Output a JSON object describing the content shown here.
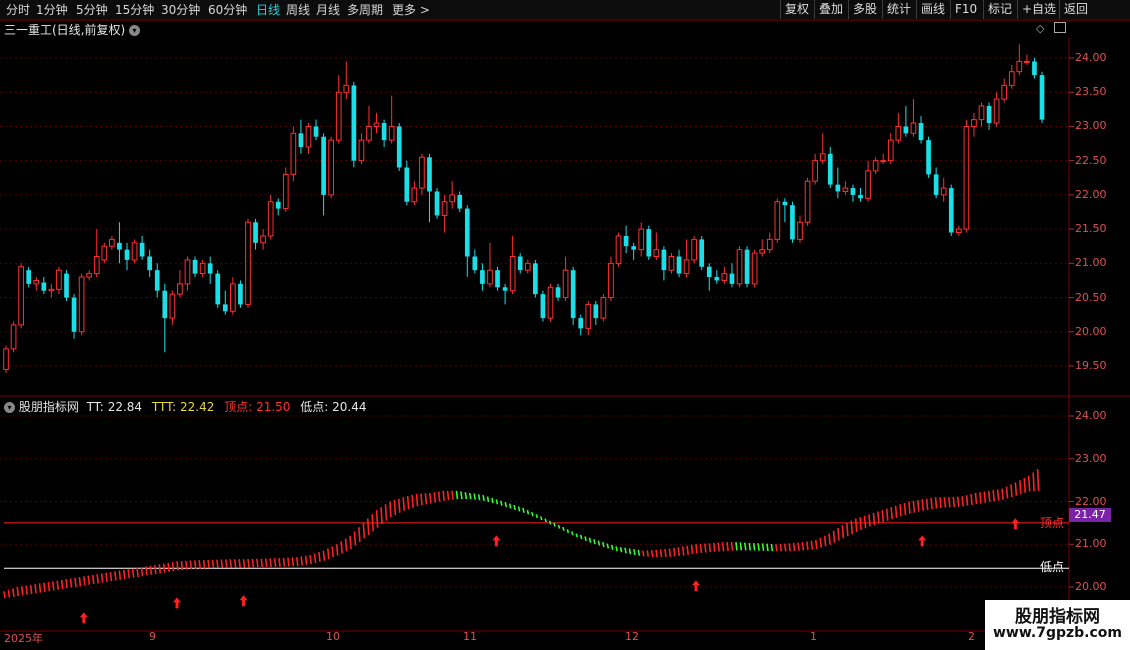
{
  "toolbar": {
    "periods": [
      "分时",
      "1分钟",
      "5分钟",
      "15分钟",
      "30分钟",
      "60分钟",
      "日线",
      "周线",
      "月线",
      "多周期",
      "更多 >"
    ],
    "active_period": "日线",
    "buttons": [
      "复权",
      "叠加",
      "多股",
      "统计",
      "画线",
      "F10",
      "标记",
      "+自选",
      "返回"
    ]
  },
  "main_chart": {
    "title": "三一重工(日线,前复权)",
    "price_labels": [
      "24.00",
      "23.50",
      "23.00",
      "22.50",
      "22.00",
      "21.50",
      "21.00",
      "20.50",
      "20.00",
      "19.50"
    ]
  },
  "indicator": {
    "name": "股朋指标网",
    "tt_label": "TT:",
    "tt_value": "22.84",
    "ttt_label": "TTT:",
    "ttt_value": "22.42",
    "top_label": "顶点:",
    "top_value": "21.50",
    "low_label": "低点:",
    "low_value": "20.44",
    "price_labels": [
      "24.00",
      "23.00",
      "22.00",
      "21.00",
      "20.00"
    ],
    "top_line_text": "顶点",
    "low_line_text": "低点",
    "current_value_badge": "21.47"
  },
  "x_axis": {
    "labels": [
      "2025年",
      "9",
      "10",
      "11",
      "12",
      "1",
      "2"
    ]
  },
  "watermark": {
    "title": "股朋指标网",
    "url": "www.7gpzb.com"
  },
  "colors": {
    "up": "#ff3030",
    "down": "#19e0e8",
    "grid": "#5a0000",
    "ind_up": "#ff2020",
    "ind_down": "#30ff30",
    "accent": "#19d6e0"
  },
  "chart_data": {
    "type": "candlestick",
    "price_range": [
      19.3,
      24.3
    ],
    "candles": [
      [
        19.45,
        19.75,
        19.4,
        19.8
      ],
      [
        19.75,
        20.1,
        19.7,
        20.15
      ],
      [
        20.1,
        20.95,
        20.05,
        21.0
      ],
      [
        20.9,
        20.7,
        20.65,
        20.95
      ],
      [
        20.7,
        20.75,
        20.6,
        20.8
      ],
      [
        20.72,
        20.6,
        20.55,
        20.8
      ],
      [
        20.6,
        20.62,
        20.5,
        20.7
      ],
      [
        20.62,
        20.9,
        20.55,
        20.95
      ],
      [
        20.85,
        20.5,
        20.45,
        20.9
      ],
      [
        20.5,
        20.0,
        19.9,
        20.55
      ],
      [
        20.0,
        20.8,
        19.95,
        20.85
      ],
      [
        20.8,
        20.85,
        20.75,
        20.9
      ],
      [
        20.85,
        21.1,
        20.8,
        21.5
      ],
      [
        21.05,
        21.25,
        21.0,
        21.3
      ],
      [
        21.25,
        21.35,
        21.2,
        21.4
      ],
      [
        21.3,
        21.2,
        21.0,
        21.6
      ],
      [
        21.2,
        21.05,
        20.9,
        21.3
      ],
      [
        21.05,
        21.3,
        21.0,
        21.35
      ],
      [
        21.3,
        21.1,
        21.05,
        21.4
      ],
      [
        21.1,
        20.9,
        20.8,
        21.2
      ],
      [
        20.9,
        20.6,
        20.5,
        21.0
      ],
      [
        20.6,
        20.2,
        19.7,
        20.7
      ],
      [
        20.2,
        20.55,
        20.1,
        20.6
      ],
      [
        20.55,
        20.7,
        20.5,
        20.9
      ],
      [
        20.7,
        21.05,
        20.6,
        21.1
      ],
      [
        21.05,
        20.85,
        20.8,
        21.1
      ],
      [
        20.85,
        21.0,
        20.8,
        21.05
      ],
      [
        21.0,
        20.85,
        20.7,
        21.1
      ],
      [
        20.85,
        20.4,
        20.35,
        20.9
      ],
      [
        20.4,
        20.3,
        20.25,
        20.6
      ],
      [
        20.3,
        20.7,
        20.25,
        20.8
      ],
      [
        20.7,
        20.4,
        20.35,
        20.75
      ],
      [
        20.4,
        21.6,
        20.35,
        21.65
      ],
      [
        21.6,
        21.3,
        21.2,
        21.65
      ],
      [
        21.3,
        21.4,
        21.2,
        21.5
      ],
      [
        21.4,
        21.9,
        21.35,
        22.0
      ],
      [
        21.9,
        21.8,
        21.7,
        21.95
      ],
      [
        21.8,
        22.3,
        21.75,
        22.4
      ],
      [
        22.3,
        22.9,
        22.2,
        23.0
      ],
      [
        22.9,
        22.7,
        22.6,
        23.1
      ],
      [
        22.7,
        23.0,
        22.6,
        23.05
      ],
      [
        23.0,
        22.85,
        22.8,
        23.1
      ],
      [
        22.85,
        22.0,
        21.7,
        22.9
      ],
      [
        22.0,
        22.8,
        21.95,
        22.85
      ],
      [
        22.8,
        23.5,
        22.75,
        23.75
      ],
      [
        23.5,
        23.6,
        23.4,
        23.95
      ],
      [
        23.6,
        22.5,
        22.4,
        23.65
      ],
      [
        22.5,
        22.8,
        22.45,
        22.9
      ],
      [
        22.8,
        23.0,
        22.75,
        23.3
      ],
      [
        23.0,
        23.05,
        22.9,
        23.2
      ],
      [
        23.05,
        22.8,
        22.7,
        23.1
      ],
      [
        22.8,
        23.0,
        22.75,
        23.45
      ],
      [
        23.0,
        22.4,
        22.35,
        23.05
      ],
      [
        22.4,
        21.9,
        21.85,
        22.5
      ],
      [
        21.9,
        22.1,
        21.85,
        22.2
      ],
      [
        22.1,
        22.55,
        22.0,
        22.6
      ],
      [
        22.55,
        22.05,
        21.6,
        22.6
      ],
      [
        22.05,
        21.7,
        21.65,
        22.1
      ],
      [
        21.7,
        21.9,
        21.45,
        22.0
      ],
      [
        21.9,
        22.0,
        21.8,
        22.2
      ],
      [
        22.0,
        21.8,
        21.75,
        22.05
      ],
      [
        21.8,
        21.1,
        20.8,
        21.85
      ],
      [
        21.1,
        20.9,
        20.85,
        21.2
      ],
      [
        20.9,
        20.7,
        20.6,
        21.0
      ],
      [
        20.7,
        20.9,
        20.65,
        21.3
      ],
      [
        20.9,
        20.65,
        20.6,
        20.95
      ],
      [
        20.65,
        20.6,
        20.4,
        20.7
      ],
      [
        20.6,
        21.1,
        20.55,
        21.4
      ],
      [
        21.1,
        20.9,
        20.85,
        21.15
      ],
      [
        20.9,
        21.0,
        20.85,
        21.05
      ],
      [
        21.0,
        20.55,
        20.5,
        21.05
      ],
      [
        20.55,
        20.2,
        20.15,
        20.6
      ],
      [
        20.2,
        20.65,
        20.15,
        20.7
      ],
      [
        20.65,
        20.5,
        20.45,
        20.7
      ],
      [
        20.5,
        20.9,
        20.45,
        21.1
      ],
      [
        20.9,
        20.2,
        20.1,
        20.95
      ],
      [
        20.2,
        20.05,
        19.95,
        20.25
      ],
      [
        20.05,
        20.4,
        19.95,
        20.45
      ],
      [
        20.4,
        20.2,
        20.1,
        20.45
      ],
      [
        20.2,
        20.5,
        20.15,
        20.55
      ],
      [
        20.5,
        21.0,
        20.45,
        21.1
      ],
      [
        21.0,
        21.4,
        20.95,
        21.45
      ],
      [
        21.4,
        21.25,
        21.15,
        21.55
      ],
      [
        21.25,
        21.2,
        21.05,
        21.3
      ],
      [
        21.2,
        21.5,
        21.1,
        21.6
      ],
      [
        21.5,
        21.1,
        21.05,
        21.55
      ],
      [
        21.1,
        21.2,
        21.05,
        21.45
      ],
      [
        21.2,
        20.9,
        20.75,
        21.25
      ],
      [
        20.9,
        21.1,
        20.85,
        21.15
      ],
      [
        21.1,
        20.85,
        20.8,
        21.2
      ],
      [
        20.85,
        21.05,
        20.8,
        21.35
      ],
      [
        21.05,
        21.35,
        21.0,
        21.4
      ],
      [
        21.35,
        20.95,
        20.9,
        21.4
      ],
      [
        20.95,
        20.8,
        20.6,
        21.0
      ],
      [
        20.8,
        20.75,
        20.7,
        20.9
      ],
      [
        20.75,
        20.85,
        20.7,
        20.95
      ],
      [
        20.85,
        20.7,
        20.65,
        21.0
      ],
      [
        20.7,
        21.2,
        20.65,
        21.25
      ],
      [
        21.2,
        20.7,
        20.65,
        21.25
      ],
      [
        20.7,
        21.15,
        20.65,
        21.2
      ],
      [
        21.15,
        21.2,
        21.1,
        21.35
      ],
      [
        21.2,
        21.35,
        21.15,
        21.45
      ],
      [
        21.35,
        21.9,
        21.3,
        21.95
      ],
      [
        21.9,
        21.85,
        21.6,
        21.95
      ],
      [
        21.85,
        21.35,
        21.3,
        21.9
      ],
      [
        21.35,
        21.6,
        21.3,
        21.7
      ],
      [
        21.6,
        22.2,
        21.55,
        22.25
      ],
      [
        22.2,
        22.5,
        22.15,
        22.6
      ],
      [
        22.5,
        22.6,
        22.45,
        22.9
      ],
      [
        22.6,
        22.15,
        22.1,
        22.7
      ],
      [
        22.15,
        22.05,
        21.95,
        22.4
      ],
      [
        22.05,
        22.1,
        22.0,
        22.2
      ],
      [
        22.1,
        22.0,
        21.9,
        22.15
      ],
      [
        22.0,
        21.95,
        21.9,
        22.1
      ],
      [
        21.95,
        22.35,
        21.9,
        22.5
      ],
      [
        22.35,
        22.5,
        22.3,
        22.55
      ],
      [
        22.5,
        22.5,
        22.45,
        22.6
      ],
      [
        22.5,
        22.8,
        22.45,
        22.9
      ],
      [
        22.8,
        23.0,
        22.75,
        23.2
      ],
      [
        23.0,
        22.9,
        22.85,
        23.3
      ],
      [
        22.9,
        23.05,
        22.85,
        23.4
      ],
      [
        23.05,
        22.8,
        22.75,
        23.15
      ],
      [
        22.8,
        22.3,
        22.25,
        22.85
      ],
      [
        22.3,
        22.0,
        21.95,
        22.4
      ],
      [
        22.0,
        22.1,
        21.9,
        22.25
      ],
      [
        22.1,
        21.45,
        21.4,
        22.15
      ],
      [
        21.45,
        21.5,
        21.4,
        21.55
      ],
      [
        21.5,
        23.0,
        21.45,
        23.1
      ],
      [
        23.0,
        23.1,
        22.85,
        23.2
      ],
      [
        23.1,
        23.3,
        23.0,
        23.35
      ],
      [
        23.3,
        23.05,
        22.95,
        23.35
      ],
      [
        23.05,
        23.4,
        23.0,
        23.5
      ],
      [
        23.4,
        23.6,
        23.35,
        23.7
      ],
      [
        23.6,
        23.8,
        23.55,
        23.9
      ],
      [
        23.8,
        23.95,
        23.75,
        24.2
      ],
      [
        23.95,
        23.95,
        23.9,
        24.05
      ],
      [
        23.95,
        23.75,
        23.7,
        24.0
      ],
      [
        23.75,
        23.1,
        23.05,
        23.8
      ]
    ],
    "ind_series_tt": [
      19.9,
      20.0,
      20.05,
      20.1,
      20.15,
      20.2,
      20.25,
      20.3,
      20.35,
      20.4,
      20.45,
      20.5,
      20.55,
      20.6,
      20.62,
      20.63,
      20.64,
      20.65,
      20.65,
      20.66,
      20.67,
      20.68,
      20.7,
      20.75,
      20.85,
      21.0,
      21.2,
      21.5,
      21.8,
      22.0,
      22.1,
      22.18,
      22.2,
      22.25,
      22.25,
      22.2,
      22.15,
      22.05,
      21.95,
      21.85,
      21.7,
      21.55,
      21.4,
      21.25,
      21.15,
      21.05,
      20.95,
      20.9,
      20.85,
      20.87,
      20.9,
      20.95,
      21.0,
      21.02,
      21.05,
      21.05,
      21.03,
      21.02,
      21.0,
      21.02,
      21.05,
      21.1,
      21.25,
      21.45,
      21.6,
      21.7,
      21.8,
      21.9,
      22.0,
      22.05,
      22.1,
      22.1,
      22.12,
      22.2,
      22.25,
      22.3,
      22.45,
      22.6,
      22.84
    ],
    "ind_series_ttt": [
      19.9,
      19.95,
      20.0,
      20.05,
      20.1,
      20.15,
      20.2,
      20.25,
      20.3,
      20.35,
      20.4,
      20.45,
      20.5,
      20.55,
      20.58,
      20.6,
      20.61,
      20.62,
      20.62,
      20.63,
      20.63,
      20.64,
      20.65,
      20.7,
      20.78,
      20.9,
      21.05,
      21.3,
      21.55,
      21.8,
      21.95,
      22.05,
      22.12,
      22.18,
      22.22,
      22.22,
      22.18,
      22.1,
      22.0,
      21.9,
      21.78,
      21.63,
      21.48,
      21.33,
      21.2,
      21.1,
      21.0,
      20.93,
      20.88,
      20.86,
      20.87,
      20.9,
      20.95,
      20.98,
      21.0,
      21.02,
      21.02,
      21.01,
      21.0,
      21.0,
      21.02,
      21.05,
      21.15,
      21.3,
      21.45,
      21.58,
      21.68,
      21.78,
      21.88,
      21.95,
      22.0,
      22.03,
      22.05,
      22.1,
      22.15,
      22.2,
      22.3,
      22.4,
      22.42
    ],
    "top_line": 21.5,
    "low_line": 20.44,
    "ind_range": [
      19.65,
      24.25
    ],
    "arrows_at": [
      6,
      13,
      18,
      37,
      52,
      69,
      76
    ]
  }
}
